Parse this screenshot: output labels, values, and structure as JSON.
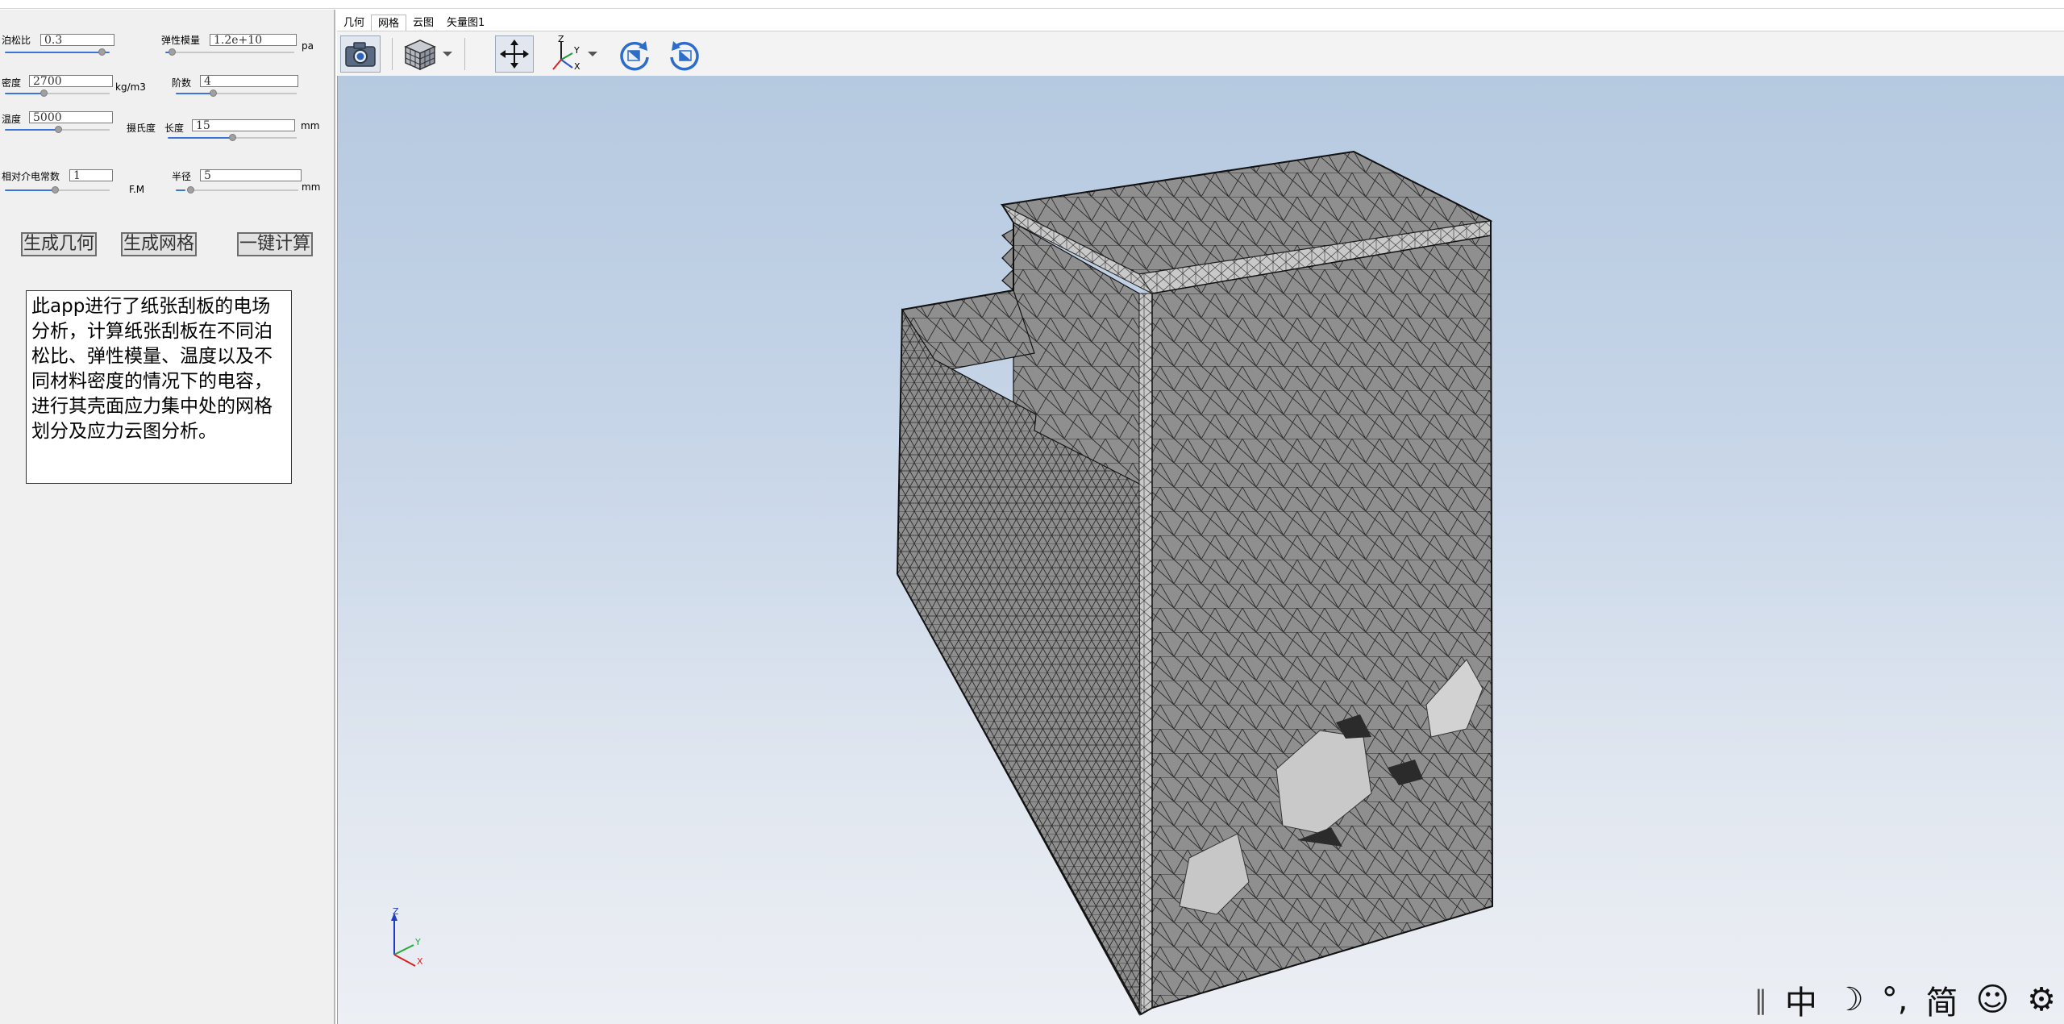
{
  "params": {
    "poisson": {
      "label": "泊松比",
      "value": "0.3",
      "slider": 0.9
    },
    "modulus": {
      "label": "弹性模量",
      "value": "1.2e+10",
      "unit": "pa",
      "slider": 0.05
    },
    "density": {
      "label": "密度",
      "value": "2700",
      "unit": "kg/m3",
      "slider": 0.35
    },
    "order": {
      "label": "阶数",
      "value": "4",
      "slider": 0.3
    },
    "temperature": {
      "label": "温度",
      "value": "5000",
      "slider": 0.5
    },
    "unit_celsius": "摄氏度",
    "length": {
      "label": "长度",
      "value": "15",
      "unit": "mm",
      "slider": 0.5
    },
    "permittivity": {
      "label": "相对介电常数",
      "value": "1",
      "unit": "F.M",
      "slider": 0.45
    },
    "radius": {
      "label": "半径",
      "value": "5",
      "unit": "mm",
      "slider": 0.1
    }
  },
  "buttons": {
    "geometry": "生成几何",
    "mesh": "生成网格",
    "compute": "一键计算"
  },
  "description": "此app进行了纸张刮板的电场分析，计算纸张刮板在不同泊松比、弹性模量、温度以及不同材料密度的情况下的电容，进行其壳面应力集中处的网格划分及应力云图分析。",
  "tabs": [
    "几何",
    "网格",
    "云图",
    "矢量图1"
  ],
  "active_tab": 1,
  "toolbar": {
    "icons": [
      "camera-icon",
      "view-cube-icon",
      "dropdown-icon",
      "zoom-extents-icon",
      "axes-icon",
      "dropdown-icon",
      "rotate-right-icon",
      "rotate-left-icon"
    ]
  },
  "triad": {
    "z": "Z",
    "y": "Y",
    "x": "X"
  },
  "ime": {
    "separator": "‖",
    "chinese": "中",
    "moon": "☽",
    "punct": "°,",
    "simplified": "简",
    "smile": "☺",
    "settings": "⚙"
  },
  "colors": {
    "accent": "#3b74d8",
    "mesh": "#8f8f8f",
    "viewport_top": "#b5c9e0"
  }
}
